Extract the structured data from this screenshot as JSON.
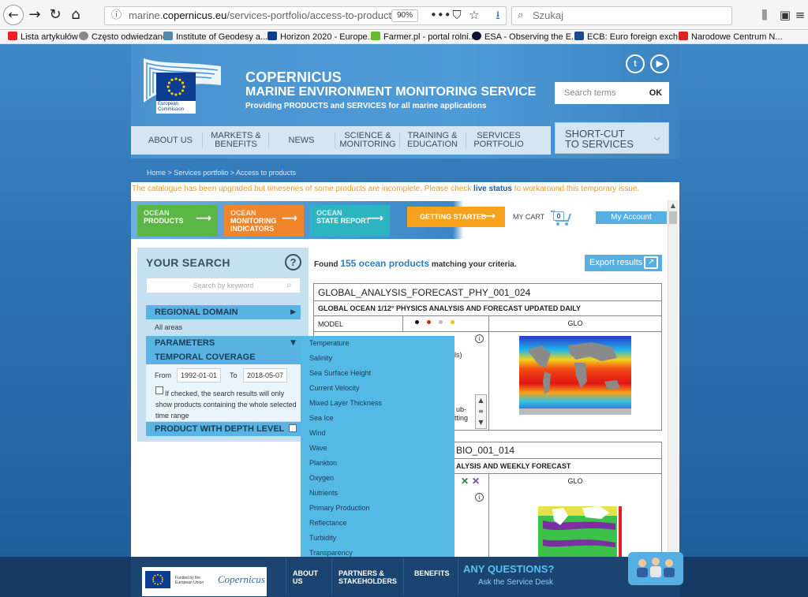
{
  "browser": {
    "url_prefix": "marine.",
    "url_domain": "copernicus.eu",
    "url_path": "/services-portfolio/access-to-products/",
    "zoom": "90%",
    "search_placeholder": "Szukaj",
    "bookmarks": [
      "Lista artykułów",
      "Często odwiedzane",
      "Institute of Geodesy a...",
      "Horizon 2020 - Europe...",
      "Farmer.pl - portal rolni...",
      "ESA - Observing the E...",
      "ECB: Euro foreign exch...",
      "Narodowe Centrum N..."
    ]
  },
  "header": {
    "ec_logo_text": "European Commission",
    "title": "COPERNICUS",
    "subtitle": "MARINE ENVIRONMENT MONITORING SERVICE",
    "tagline": "Providing PRODUCTS and SERVICES for all marine applications",
    "search_placeholder": "Search terms",
    "search_ok": "OK",
    "twitter": "t",
    "youtube": "▶"
  },
  "nav": {
    "items": [
      "ABOUT US",
      "MARKETS & BENEFITS",
      "NEWS",
      "SCIENCE & MONITORING",
      "TRAINING & EDUCATION",
      "SERVICES PORTFOLIO"
    ],
    "items_line1": [
      "ABOUT US",
      "MARKETS &",
      "NEWS",
      "SCIENCE &",
      "TRAINING &",
      "SERVICES"
    ],
    "items_line2": [
      "",
      "BENEFITS",
      "",
      "MONITORING",
      "EDUCATION",
      "PORTFOLIO"
    ],
    "shortcut_line1": "SHORT-CUT",
    "shortcut_line2": "TO SERVICES"
  },
  "breadcrumb": "Home > Services portfolio > Access to products",
  "notice": {
    "before": "The catalogue has been upgraded but timeseries of some products are incomplete. Please check ",
    "link": "live status",
    "after": " to workaround this temporary issue."
  },
  "tiles": [
    {
      "small": "OCEAN",
      "label": "PRODUCTS",
      "color": "#5cb646"
    },
    {
      "small": "OCEAN",
      "label": "MONITORING",
      "label2": "INDICATORS",
      "color": "#f0852c"
    },
    {
      "small": "OCEAN",
      "label": "STATE REPORT",
      "color": "#2cb5c0"
    }
  ],
  "getting_started": "GETTING STARTED",
  "cart": {
    "label": "MY CART",
    "count": "0"
  },
  "my_account": "My Account",
  "left_panel": {
    "title": "YOUR SEARCH",
    "help": "?",
    "keyword_placeholder": "Search by keyword",
    "regional_domain": "REGIONAL DOMAIN",
    "all_areas": "All areas",
    "parameters": "PARAMETERS",
    "temporal_coverage": "TEMPORAL COVERAGE",
    "from_label": "From",
    "from_value": "1992-01-01",
    "to_label": "To",
    "to_value": "2018-05-07",
    "checkbox_text": "If checked, the search results will only show products containing the whole selected time range",
    "depth_level": "PRODUCT WITH DEPTH LEVEL"
  },
  "results": {
    "found_prefix": "Found ",
    "count": "155 ocean products",
    "found_suffix": " matching your criteria.",
    "export": "Export results"
  },
  "product1": {
    "id": "GLOBAL_ANALYSIS_FORECAST_PHY_001_024",
    "name": "GLOBAL OCEAN 1/12° PHYSICS ANALYSIS AND FORECAST UPDATED DAILY",
    "model": "MODEL",
    "area": "GLO",
    "partial1": "ls)",
    "partial2": "ub-",
    "partial3": "tting"
  },
  "product2": {
    "id_partial": "BIO_001_014",
    "name_partial": "ALYSIS AND WEEKLY FORECAST",
    "area": "GLO"
  },
  "parameters_options": [
    "Temperature",
    "Salinity",
    "Sea Surface Height",
    "Current Velocity",
    "Mixed Layer Thickness",
    "Sea Ice",
    "Wind",
    "Wave",
    "Plankton",
    "Oxygen",
    "Nutrients",
    "Primary Production",
    "Reflectance",
    "Turbidity",
    "Transparency"
  ],
  "footer": {
    "funded_text": "Funded by the European Union",
    "copernicus": "Copernicus",
    "about_line1": "ABOUT",
    "about_line2": "US",
    "partners_line1": "PARTNERS &",
    "partners_line2": "STAKEHOLDERS",
    "benefits": "BENEFITS",
    "any_questions": "ANY QUESTIONS?",
    "ask": "Ask the Service Desk"
  },
  "colors": {
    "accent": "#57aee0",
    "header": "#4a93d0",
    "orange": "#f7a21c"
  }
}
